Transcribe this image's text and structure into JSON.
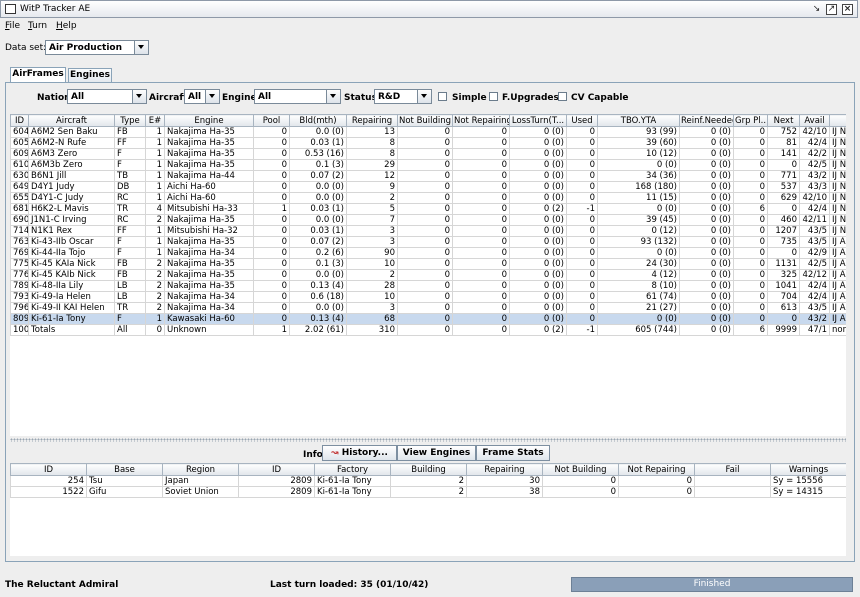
{
  "window": {
    "title": "WitP Tracker AE"
  },
  "menu": {
    "file": "File",
    "turn": "Turn",
    "help": "Help"
  },
  "dataset": {
    "label": "Data set:",
    "value": "Air Production"
  },
  "tabs": {
    "airframes": "AirFrames",
    "engines": "Engines"
  },
  "filters": {
    "nation_label": "Nation:",
    "nation_value": "All",
    "aircraft_label": "Aircraft:",
    "aircraft_value": "All",
    "engine_label": "Engine:",
    "engine_value": "All",
    "status_label": "Status:",
    "status_value": "R&D",
    "simple": "Simple",
    "fupgrades": "F.Upgrades",
    "cvcapable": "CV Capable"
  },
  "main_table": {
    "columns": [
      "ID",
      "Aircraft",
      "Type",
      "E#",
      "Engine",
      "Pool",
      "Bld(mth)",
      "Repairing",
      "Not Building",
      "Not Repairing",
      "LossTurn(T...",
      "Used",
      "TBO.YTA",
      "Reinf.Needed",
      "Grp Pl...",
      "Next",
      "Avail",
      "Nat"
    ],
    "rows": [
      [
        "604",
        "A6M2 Sen Baku",
        "FB",
        "1",
        "Nakajima Ha-35",
        "0",
        "0.0 (0)",
        "13",
        "0",
        "0",
        "0 (0)",
        "0",
        "93 (99)",
        "0 (0)",
        "0",
        "752",
        "42/10",
        "IJ Navy"
      ],
      [
        "605",
        "A6M2-N Rufe",
        "FF",
        "1",
        "Nakajima Ha-35",
        "0",
        "0.03 (1)",
        "8",
        "0",
        "0",
        "0 (0)",
        "0",
        "39 (60)",
        "0 (0)",
        "0",
        "81",
        "42/4",
        "IJ Navy"
      ],
      [
        "609",
        "A6M3 Zero",
        "F",
        "1",
        "Nakajima Ha-35",
        "0",
        "0.53 (16)",
        "8",
        "0",
        "0",
        "0 (0)",
        "0",
        "10 (12)",
        "0 (0)",
        "0",
        "141",
        "42/2",
        "IJ Navy"
      ],
      [
        "610",
        "A6M3b Zero",
        "F",
        "1",
        "Nakajima Ha-35",
        "0",
        "0.1 (3)",
        "29",
        "0",
        "0",
        "0 (0)",
        "0",
        "0 (0)",
        "0 (0)",
        "0",
        "0",
        "42/5",
        "IJ Navy"
      ],
      [
        "630",
        "B6N1 Jill",
        "TB",
        "1",
        "Nakajima Ha-44",
        "0",
        "0.07 (2)",
        "12",
        "0",
        "0",
        "0 (0)",
        "0",
        "34 (36)",
        "0 (0)",
        "0",
        "771",
        "43/2",
        "IJ Navy"
      ],
      [
        "649",
        "D4Y1 Judy",
        "DB",
        "1",
        "Aichi Ha-60",
        "0",
        "0.0 (0)",
        "9",
        "0",
        "0",
        "0 (0)",
        "0",
        "168 (180)",
        "0 (0)",
        "0",
        "537",
        "43/3",
        "IJ Navy"
      ],
      [
        "655",
        "D4Y1-C Judy",
        "RC",
        "1",
        "Aichi Ha-60",
        "0",
        "0.0 (0)",
        "2",
        "0",
        "0",
        "0 (0)",
        "0",
        "11 (15)",
        "0 (0)",
        "0",
        "629",
        "42/10",
        "IJ Navy"
      ],
      [
        "681",
        "H6K2-L Mavis",
        "TR",
        "4",
        "Mitsubishi Ha-33",
        "1",
        "0.03 (1)",
        "5",
        "0",
        "0",
        "0 (2)",
        "-1",
        "0 (0)",
        "0 (0)",
        "6",
        "0",
        "42/4",
        "IJ Navy"
      ],
      [
        "690",
        "J1N1-C Irving",
        "RC",
        "2",
        "Nakajima Ha-35",
        "0",
        "0.0 (0)",
        "7",
        "0",
        "0",
        "0 (0)",
        "0",
        "39 (45)",
        "0 (0)",
        "0",
        "460",
        "42/11",
        "IJ Navy"
      ],
      [
        "714",
        "N1K1 Rex",
        "FF",
        "1",
        "Mitsubishi Ha-32",
        "0",
        "0.03 (1)",
        "3",
        "0",
        "0",
        "0 (0)",
        "0",
        "0 (12)",
        "0 (0)",
        "0",
        "1207",
        "43/5",
        "IJ Navy"
      ],
      [
        "763",
        "Ki-43-IIb Oscar",
        "F",
        "1",
        "Nakajima Ha-35",
        "0",
        "0.07 (2)",
        "3",
        "0",
        "0",
        "0 (0)",
        "0",
        "93 (132)",
        "0 (0)",
        "0",
        "735",
        "43/5",
        "IJ Army"
      ],
      [
        "769",
        "Ki-44-IIa Tojo",
        "F",
        "1",
        "Nakajima Ha-34",
        "0",
        "0.2 (6)",
        "90",
        "0",
        "0",
        "0 (0)",
        "0",
        "0 (0)",
        "0 (0)",
        "0",
        "0",
        "42/9",
        "IJ Army"
      ],
      [
        "775",
        "Ki-45 KAIa Nick",
        "FB",
        "2",
        "Nakajima Ha-35",
        "0",
        "0.1 (3)",
        "10",
        "0",
        "0",
        "0 (0)",
        "0",
        "24 (30)",
        "0 (0)",
        "0",
        "1131",
        "42/5",
        "IJ Army"
      ],
      [
        "776",
        "Ki-45 KAIb Nick",
        "FB",
        "2",
        "Nakajima Ha-35",
        "0",
        "0.0 (0)",
        "2",
        "0",
        "0",
        "0 (0)",
        "0",
        "4 (12)",
        "0 (0)",
        "0",
        "325",
        "42/12",
        "IJ Army"
      ],
      [
        "789",
        "Ki-48-IIa Lily",
        "LB",
        "2",
        "Nakajima Ha-35",
        "0",
        "0.13 (4)",
        "28",
        "0",
        "0",
        "0 (0)",
        "0",
        "8 (10)",
        "0 (0)",
        "0",
        "1041",
        "42/4",
        "IJ Army"
      ],
      [
        "793",
        "Ki-49-Ia Helen",
        "LB",
        "2",
        "Nakajima Ha-34",
        "0",
        "0.6 (18)",
        "10",
        "0",
        "0",
        "0 (0)",
        "0",
        "61 (74)",
        "0 (0)",
        "0",
        "704",
        "42/4",
        "IJ Army"
      ],
      [
        "796",
        "Ki-49-II KAI Helen",
        "TR",
        "2",
        "Nakajima Ha-34",
        "0",
        "0.0 (0)",
        "3",
        "0",
        "0",
        "0 (0)",
        "0",
        "21 (27)",
        "0 (0)",
        "0",
        "613",
        "43/5",
        "IJ Army"
      ],
      [
        "809",
        "Ki-61-Ia Tony",
        "F",
        "1",
        "Kawasaki Ha-60",
        "0",
        "0.13 (4)",
        "68",
        "0",
        "0",
        "0 (0)",
        "0",
        "0 (0)",
        "0 (0)",
        "0",
        "0",
        "43/2",
        "IJ Army"
      ],
      [
        "1000",
        "Totals",
        "All",
        "0",
        "Unknown",
        "1",
        "2.02 (61)",
        "310",
        "0",
        "0",
        "0 (2)",
        "-1",
        "605 (744)",
        "0 (0)",
        "6",
        "9999",
        "47/1",
        "none"
      ]
    ]
  },
  "info": {
    "label": "Info:",
    "history": "History...",
    "view_engines": "View Engines",
    "frame_stats": "Frame Stats"
  },
  "detail_table": {
    "columns": [
      "ID",
      "Base",
      "Region",
      "ID",
      "Factory",
      "Building",
      "Repairing",
      "Not Building",
      "Not Repairing",
      "Fail",
      "Warnings"
    ],
    "rows": [
      [
        "254",
        "Tsu",
        "Japan",
        "2809",
        "Ki-61-Ia Tony",
        "2",
        "30",
        "0",
        "0",
        "",
        "Sy = 15556"
      ],
      [
        "1522",
        "Gifu",
        "Soviet Union",
        "2809",
        "Ki-61-Ia Tony",
        "2",
        "38",
        "0",
        "0",
        "",
        "Sy = 14315"
      ]
    ]
  },
  "status": {
    "left": "The Reluctant Admiral",
    "center": "Last turn loaded: 35 (01/10/42)",
    "progress_label": "Finished",
    "progress": 1.0
  }
}
